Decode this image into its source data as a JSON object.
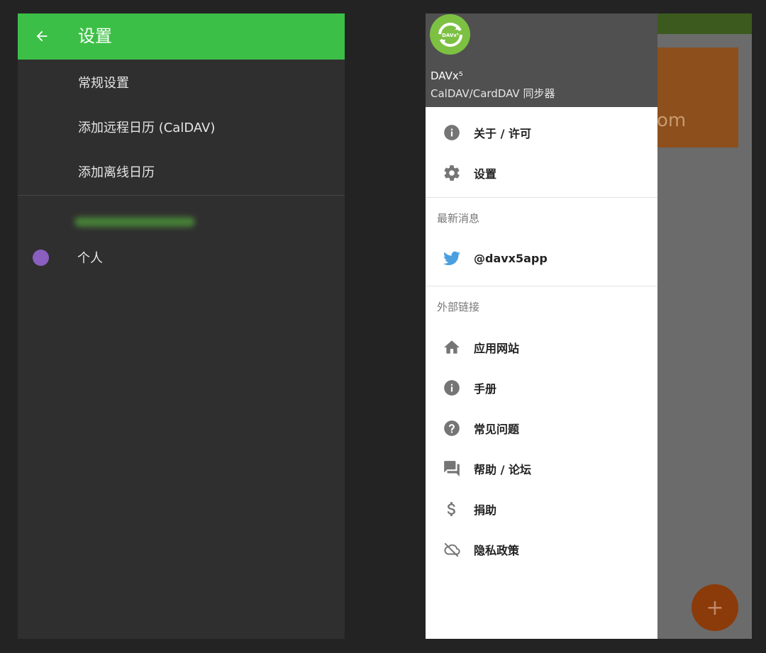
{
  "left": {
    "title": "设置",
    "menu": [
      "常规设置",
      "添加远程日历 (CalDAV)",
      "添加离线日历"
    ],
    "calendar": {
      "label": "个人",
      "color": "#8a5fc0"
    },
    "toolbar_color": "#3cbf46"
  },
  "right": {
    "header": {
      "app_name": "DAVx⁵",
      "app_subtitle": "CalDAV/CardDAV 同步器",
      "logo_text": "DAVx⁵"
    },
    "items_top": [
      {
        "icon": "info-icon",
        "label": "关于 / 许可"
      },
      {
        "icon": "gear-icon",
        "label": "设置"
      }
    ],
    "news": {
      "title": "最新消息",
      "twitter_label": "@davx5app"
    },
    "links": {
      "title": "外部链接",
      "items": [
        {
          "icon": "home-icon",
          "label": "应用网站"
        },
        {
          "icon": "info-icon",
          "label": "手册"
        },
        {
          "icon": "help-icon",
          "label": "常见问题"
        },
        {
          "icon": "forum-icon",
          "label": "帮助 / 论坛"
        },
        {
          "icon": "dollar-icon",
          "label": "捐助"
        },
        {
          "icon": "cloud-off-icon",
          "label": "隐私政策"
        }
      ]
    },
    "background": {
      "card_text": "om",
      "fab_label": "+"
    }
  }
}
